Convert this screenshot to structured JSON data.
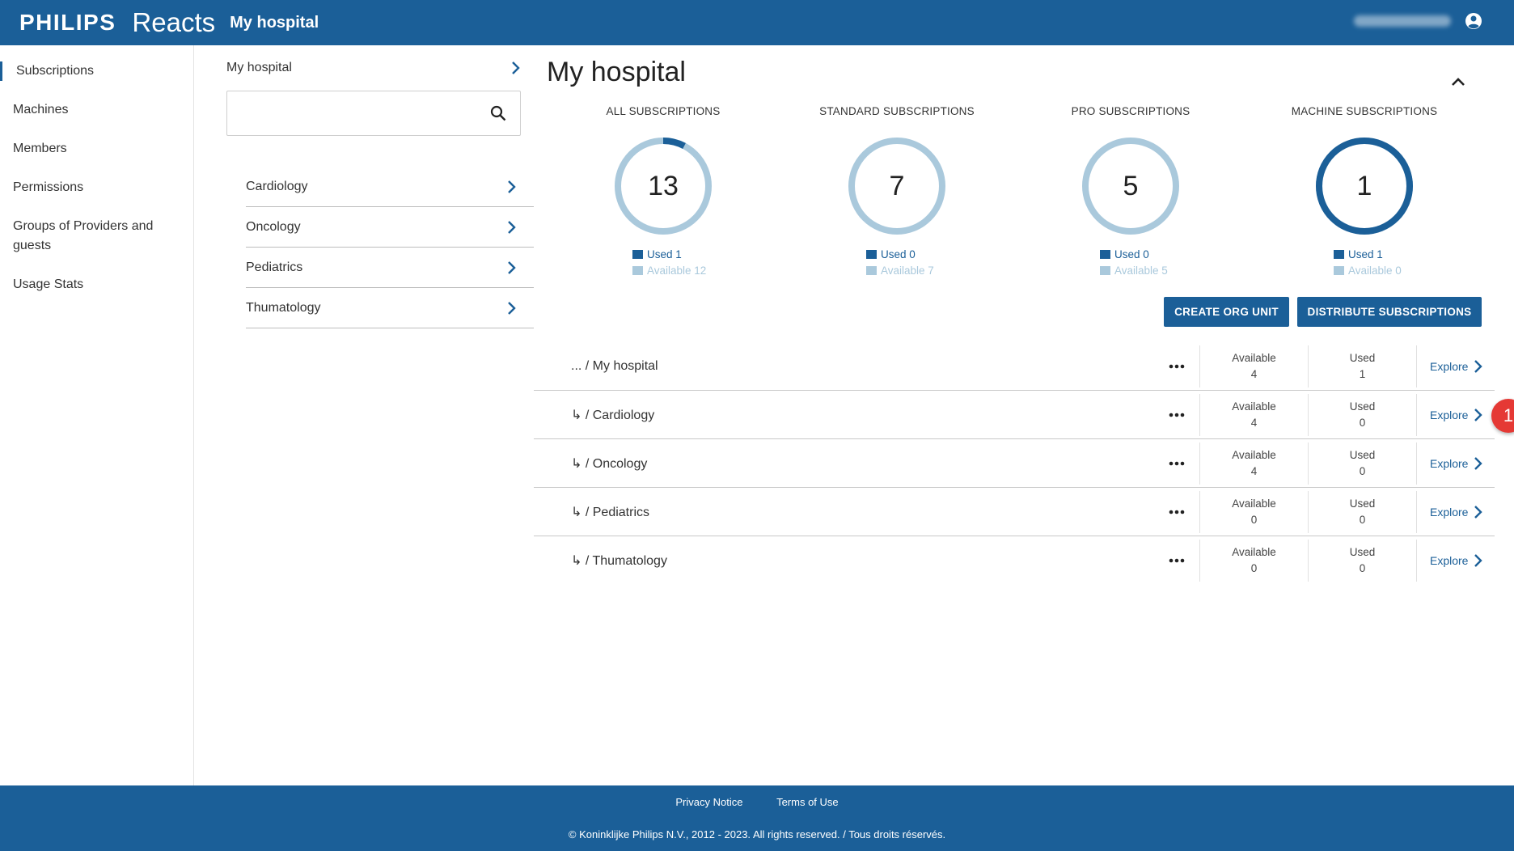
{
  "header": {
    "logo": "PHILIPS",
    "product": "Reacts",
    "title": "My hospital"
  },
  "colors": {
    "brand": "#1b5f98",
    "used": "#1b5f98",
    "available": "#aac9dc",
    "badge": "#e53935"
  },
  "sidebar": {
    "items": [
      {
        "label": "Subscriptions",
        "active": true
      },
      {
        "label": "Machines"
      },
      {
        "label": "Members"
      },
      {
        "label": "Permissions"
      },
      {
        "label": "Groups of Providers and guests"
      },
      {
        "label": "Usage Stats"
      }
    ]
  },
  "tree": {
    "root": "My hospital",
    "search": {
      "value": "",
      "placeholder": ""
    },
    "items": [
      "Cardiology",
      "Oncology",
      "Pediatrics",
      "Thumatology"
    ]
  },
  "main": {
    "title": "My hospital",
    "stats": [
      {
        "title": "ALL SUBSCRIPTIONS",
        "total": "13",
        "used": 1,
        "available": 12,
        "used_label": "Used 1",
        "available_label": "Available 12"
      },
      {
        "title": "STANDARD SUBSCRIPTIONS",
        "total": "7",
        "used": 0,
        "available": 7,
        "used_label": "Used 0",
        "available_label": "Available 7"
      },
      {
        "title": "PRO SUBSCRIPTIONS",
        "total": "5",
        "used": 0,
        "available": 5,
        "used_label": "Used 0",
        "available_label": "Available 5"
      },
      {
        "title": "MACHINE SUBSCRIPTIONS",
        "total": "1",
        "used": 1,
        "available": 0,
        "used_label": "Used 1",
        "available_label": "Available 0"
      }
    ],
    "buttons": {
      "create": "CREATE ORG UNIT",
      "distribute": "DISTRIBUTE SUBSCRIPTIONS"
    },
    "table": {
      "available_label": "Available",
      "used_label": "Used",
      "explore_label": "Explore",
      "rows": [
        {
          "name": "... / My hospital",
          "available": "4",
          "used": "1"
        },
        {
          "name": "↳ / Cardiology",
          "available": "4",
          "used": "0"
        },
        {
          "name": "↳ / Oncology",
          "available": "4",
          "used": "0"
        },
        {
          "name": "↳ / Pediatrics",
          "available": "0",
          "used": "0"
        },
        {
          "name": "↳ / Thumatology",
          "available": "0",
          "used": "0"
        }
      ]
    },
    "badge": "1"
  },
  "footer": {
    "privacy": "Privacy Notice",
    "terms": "Terms of Use",
    "copyright": "© Koninklijke Philips N.V., 2012 - 2023. All rights reserved. / Tous droits réservés."
  }
}
